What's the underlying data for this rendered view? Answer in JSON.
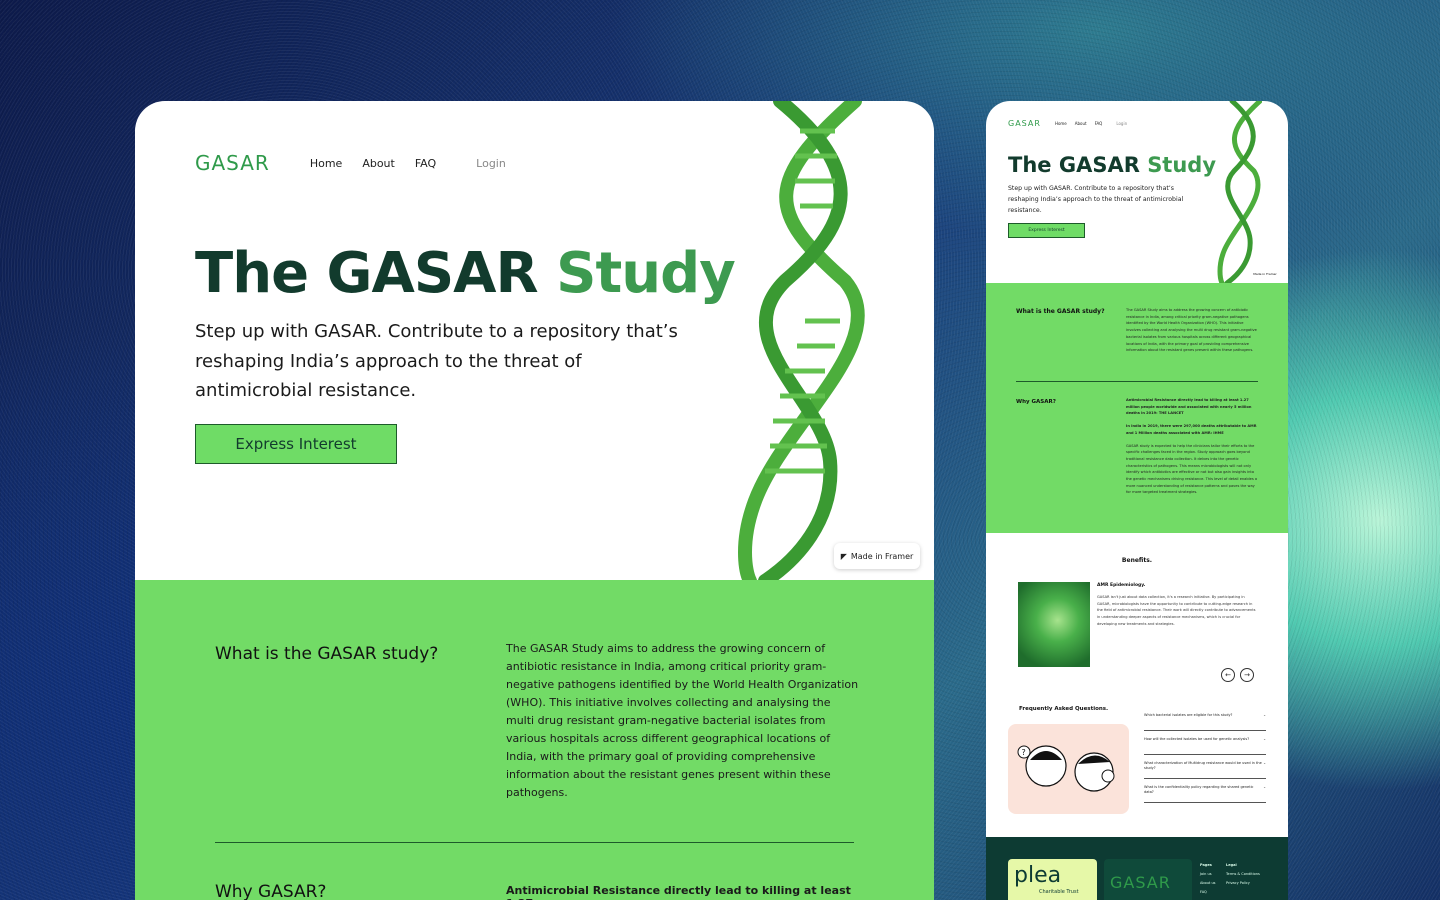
{
  "brand": {
    "logo": "GASAR"
  },
  "nav": {
    "items": [
      "Home",
      "About",
      "FAQ"
    ],
    "login": "Login"
  },
  "hero": {
    "title_part1": "The GASAR ",
    "title_part2": "Study",
    "subtitle": "Step up with GASAR. Contribute to a repository that’s reshaping India’s approach to the threat of antimicrobial resistance.",
    "cta": "Express Interest",
    "badge": "Made in Framer"
  },
  "sections": {
    "what": {
      "question": "What is the GASAR study?",
      "answer": "The GASAR Study aims to address the growing concern of antibiotic resistance in India, among critical priority gram-negative pathogens identified by the World Health Organization (WHO). This initiative involves collecting and analysing the multi drug resistant gram-negative bacterial isolates from various hospitals across different geographical locations of India, with the primary goal of providing comprehensive information about the resistant genes present within these pathogens."
    },
    "why": {
      "question": "Why GASAR?",
      "answer_lead": "Antimicrobial Resistance directly lead to killing at least 1.27",
      "mobile_p1": "Antimicrobial Resistance directly lead to killing at least 1.27 million people worldwide and associated with nearly 5 million deaths in 2019: THE LANCET",
      "mobile_p2": "In India in 2019, there were 297,000 deaths attributable to AMR and 1 Million deaths associated with AMR: IHME",
      "mobile_p3": "GASAR study is expected to help the clinicians tailor their efforts to the specific challenges faced in the region. Study approach goes beyond traditional resistance data collection. It delves into the genetic characteristics of pathogens. This means microbiologists will not only identify which antibiotics are effective or not but also gain insights into the genetic mechanisms driving resistance. This level of detail enables a more nuanced understanding of resistance patterns and paves the way for more targeted treatment strategies."
    }
  },
  "benefits": {
    "title": "Benefits.",
    "item_title": "AMR Epidemiology.",
    "item_text": "GASAR isn't just about data collection, it's a research initiative. By participating in GASAR, microbiologists have the opportunity to contribute to cutting-edge research in the field of antimicrobial resistance. Their work will directly contribute to advancements in understanding deeper aspects of resistance mechanisms, which is crucial for developing new treatments and strategies.",
    "prev": "←",
    "next": "→"
  },
  "faq": {
    "title": "Frequently Asked Questions.",
    "items": [
      "Which bacterial isolates are eligible for this study?",
      "How will the collected isolates be used for genetic analysis?",
      "What characterization of Multidrug resistance would be used in the study?",
      "What is the confidentiality policy regarding the shared genetic data?"
    ],
    "chevron": "⌄"
  },
  "footer": {
    "partner_name": "plea",
    "partner_sub": "Charitable Trust",
    "logo": "GASAR",
    "pages_title": "Pages",
    "pages": [
      "Join us",
      "About us",
      "FAQ"
    ],
    "legal_title": "Legal",
    "legal": [
      "Terms & Conditions",
      "Privacy Policy"
    ]
  },
  "colors": {
    "green": "#72db66",
    "dark": "#123b2d",
    "accent": "#3d9a50",
    "footer": "#0d3b33"
  }
}
